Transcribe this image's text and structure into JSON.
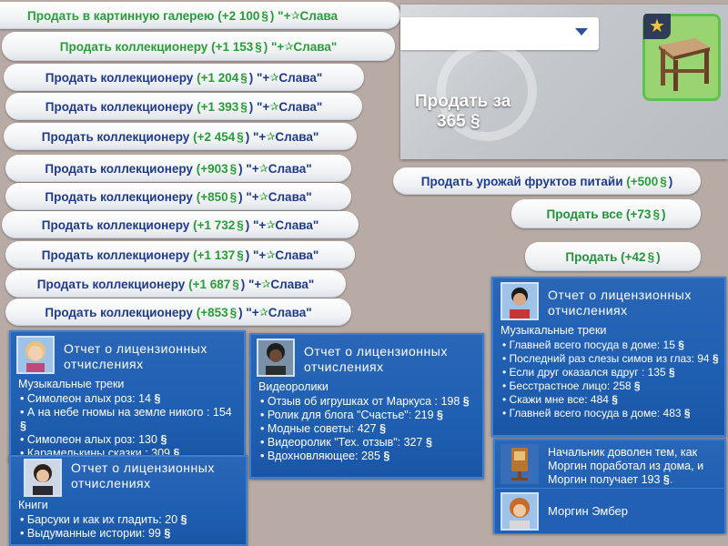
{
  "sell_buttons": [
    {
      "label": "Продать в картинную галерею",
      "amount": "(+2 100",
      "suffix": ") \"+",
      "fame": "Слава"
    },
    {
      "label": "Продать коллекционеру",
      "amount": "(+1 153",
      "suffix": ") \"+",
      "fame": "Слава\""
    },
    {
      "label": "Продать коллекционеру",
      "amount": "(+1 204",
      "suffix": ") \"+",
      "fame": "Слава\""
    },
    {
      "label": "Продать коллекционеру",
      "amount": "(+1 393",
      "suffix": ") \"+",
      "fame": "Слава\""
    },
    {
      "label": "Продать коллекционеру",
      "amount": "(+2 454",
      "suffix": ") \"+",
      "fame": "Слава\""
    },
    {
      "label": "Продать коллекционеру",
      "amount": "(+903",
      "suffix": ") \"+",
      "fame": "Слава\""
    },
    {
      "label": "Продать коллекционеру",
      "amount": "(+850",
      "suffix": ") \"+",
      "fame": "Слава\""
    },
    {
      "label": "Продать коллекционеру",
      "amount": "(+1 732",
      "suffix": ") \"+",
      "fame": "Слава\""
    },
    {
      "label": "Продать коллекционеру",
      "amount": "(+1 137",
      "suffix": ") \"+",
      "fame": "Слава\""
    },
    {
      "label": "Продать коллекционеру",
      "amount": "(+1 687",
      "suffix": ") \"+",
      "fame": "Слава\""
    },
    {
      "label": "Продать коллекционеру",
      "amount": "(+853",
      "suffix": ") \"+",
      "fame": "Слава\""
    }
  ],
  "sell_panel": {
    "label": "Продать за",
    "price": "365",
    "dropdown_value": ""
  },
  "right_buttons": {
    "pitaya": {
      "label": "Продать урожай фруктов питайи",
      "amount": "(+500",
      "close": ")"
    },
    "sell_all": {
      "label": "Продать все",
      "amount": "(+73",
      "close": ")"
    },
    "sell": {
      "label": "Продать",
      "amount": "(+42",
      "close": ")"
    }
  },
  "notifications": {
    "music_left": {
      "title": "Отчет о лицензионных отчислениях",
      "category": "Музыкальные треки",
      "items": [
        "Симолеон алых роз: 14",
        "А на небе гномы на земле никого : 154",
        "Симолеон алых роз: 130",
        "Карамелькины сказки  : 309"
      ]
    },
    "videos": {
      "title": "Отчет о лицензионных отчислениях",
      "category": "Видеоролики",
      "items": [
        "Отзыв об игрушках от Маркуса : 198",
        "Ролик для блога \"Счастье\": 219",
        "Модные советы: 427",
        "Видеоролик \"Тех. отзыв\": 327",
        "Вдохновляющее: 285"
      ]
    },
    "books": {
      "title": "Отчет о лицензионных отчислениях",
      "category": "Книги",
      "items": [
        "Барсуки и как их гладить: 20",
        "Выдуманные истории: 99"
      ]
    },
    "music_right": {
      "title": "Отчет о лицензионных отчислениях",
      "category": "Музыкальные треки",
      "items": [
        "Главней всего посуда в доме: 15",
        "Последний раз слезы симов из глаз: 94",
        "Если друг оказался вдруг : 135",
        "Бесстрастное лицо: 258",
        "Скажи мне все: 484",
        "Главней всего посуда в доме: 483"
      ]
    },
    "boss": {
      "message": "Начальник доволен тем, как Моргин поработал из дома, и Моргин получает 193",
      "end": ".",
      "name": "Моргин Эмбер"
    }
  },
  "icons": {
    "simoleon": "§",
    "star": "✰"
  },
  "colors": {
    "button_text": "#1f3a8c",
    "green": "#2b9c3a",
    "notif_bg": "#1f5fb2"
  }
}
